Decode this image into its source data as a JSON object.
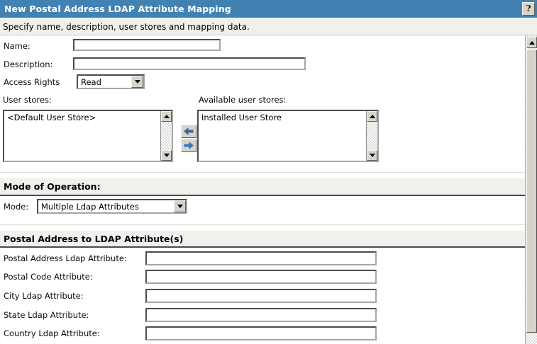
{
  "title_bar": {
    "title": "New Postal Address LDAP Attribute Mapping",
    "help_label": "?"
  },
  "subtitle": "Specify name, description, user stores and mapping data.",
  "form": {
    "name": {
      "label": "Name:",
      "value": ""
    },
    "description": {
      "label": "Description:",
      "value": ""
    },
    "access_rights": {
      "label": "Access Rights",
      "selected": "Read"
    },
    "user_stores": {
      "label": "User stores:",
      "items": [
        "<Default User Store>"
      ]
    },
    "available_user_stores": {
      "label": "Available user stores:",
      "items": [
        "Installed User Store"
      ]
    }
  },
  "mode_section": {
    "header": "Mode of Operation:",
    "mode": {
      "label": "Mode:",
      "selected": "Multiple Ldap Attributes"
    }
  },
  "postal_section": {
    "header": "Postal Address to LDAP Attribute(s)",
    "fields": [
      {
        "label": "Postal Address Ldap Attribute:",
        "value": ""
      },
      {
        "label": "Postal Code Attribute:",
        "value": ""
      },
      {
        "label": "City Ldap Attribute:",
        "value": ""
      },
      {
        "label": "State Ldap Attribute:",
        "value": ""
      },
      {
        "label": "Country Ldap Attribute:",
        "value": ""
      }
    ]
  },
  "icons": {
    "help": "question-mark-icon",
    "dropdown": "chevron-down-icon",
    "transfer_left": "left-arrow-icon",
    "transfer_right": "right-arrow-icon",
    "scroll_up": "up-triangle-icon",
    "scroll_down": "down-triangle-icon"
  },
  "colors": {
    "title_bar_bg": "#4282B2",
    "title_text": "#FFFFFF",
    "subtitle_bg": "#F1F0EC",
    "section_band_bg": "#F1F0EC",
    "section_band_border": "#4B4B4B",
    "button_face": "#D8D4CC",
    "arrow_left_blue": "#38699E",
    "arrow_right_blue": "#2E7CC3"
  }
}
